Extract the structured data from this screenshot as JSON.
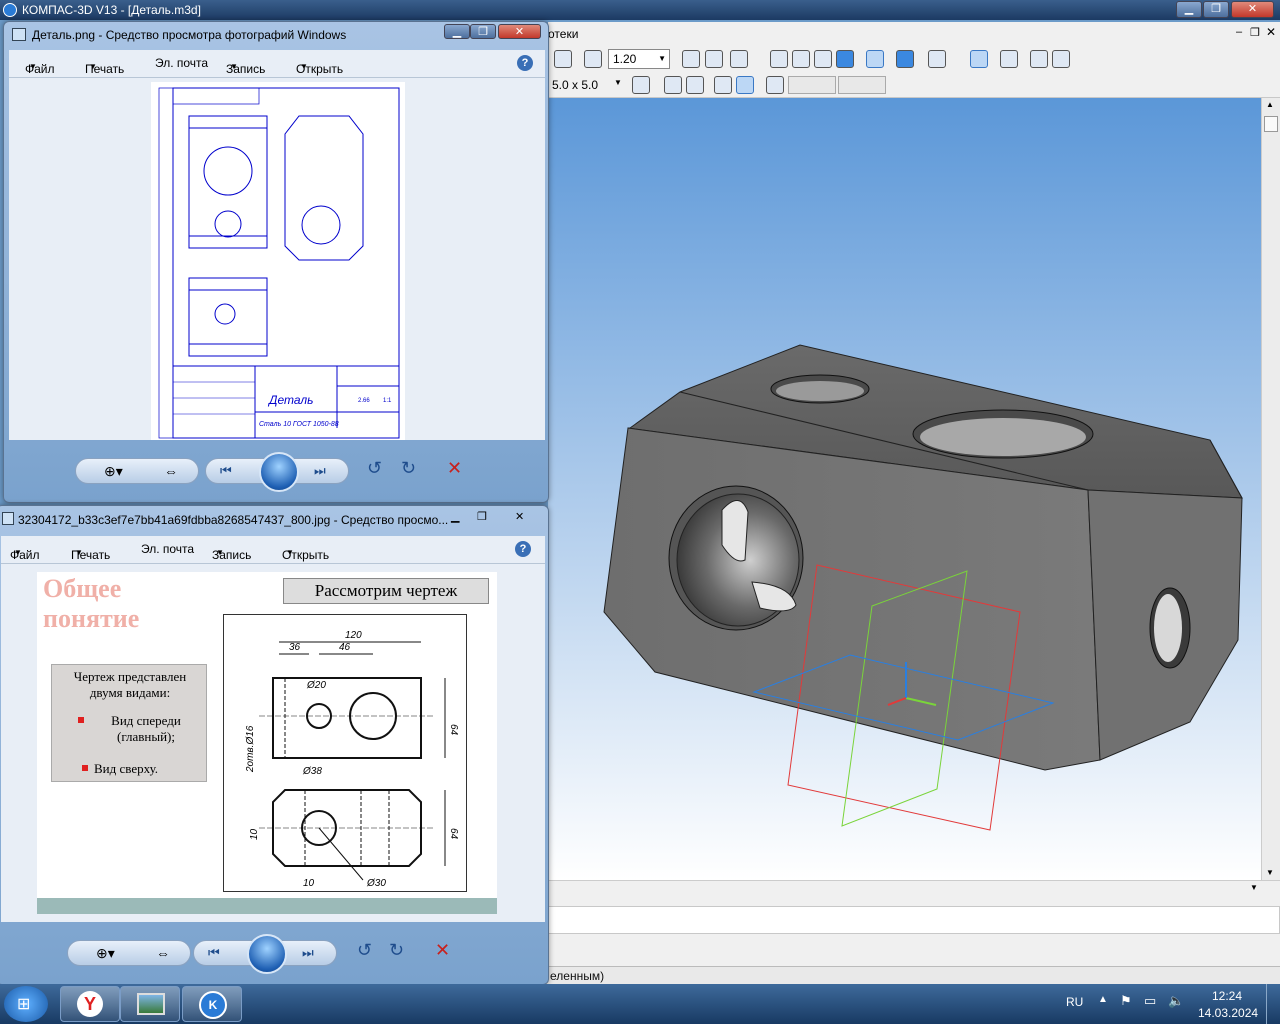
{
  "kompas": {
    "title": "КОМПАС-3D V13 - [Деталь.m3d]",
    "menu_tail": "отеки",
    "zoom_value": "1.20",
    "grid_value": "5.0 x 5.0",
    "status_text": "еленным)"
  },
  "viewer1": {
    "title": "Деталь.png - Средство просмотра фотографий Windows",
    "menu": [
      "Файл",
      "Печать",
      "Эл. почта",
      "Запись",
      "Открыть"
    ],
    "drawing": {
      "title": "Деталь",
      "material": "Сталь 10 ГОСТ 1050-88",
      "scale": "1:1",
      "mass": "2.66"
    }
  },
  "viewer2": {
    "title": "32304172_b33c3ef7e7bb41a69fdbba8268547437_800.jpg - Средство просмо...",
    "menu": [
      "Файл",
      "Печать",
      "Эл. почта",
      "Запись",
      "Открыть"
    ],
    "slide": {
      "heading_line1": "Общее",
      "heading_line2": "понятие",
      "banner": "Рассмотрим чертеж",
      "box_text": "Чертеж представлен двумя видами:",
      "bullet1": "Вид спереди (главный);",
      "bullet2": "Вид сверху.",
      "dims": {
        "d120": "120",
        "d36": "36",
        "d46": "46",
        "d20": "Ø20",
        "d38": "Ø38",
        "d64a": "64",
        "d64b": "64",
        "holes": "2отв.Ø16",
        "d10a": "10",
        "d10b": "10",
        "d30": "Ø30"
      }
    }
  },
  "taskbar": {
    "lang": "RU",
    "time": "12:24",
    "date": "14.03.2024"
  }
}
